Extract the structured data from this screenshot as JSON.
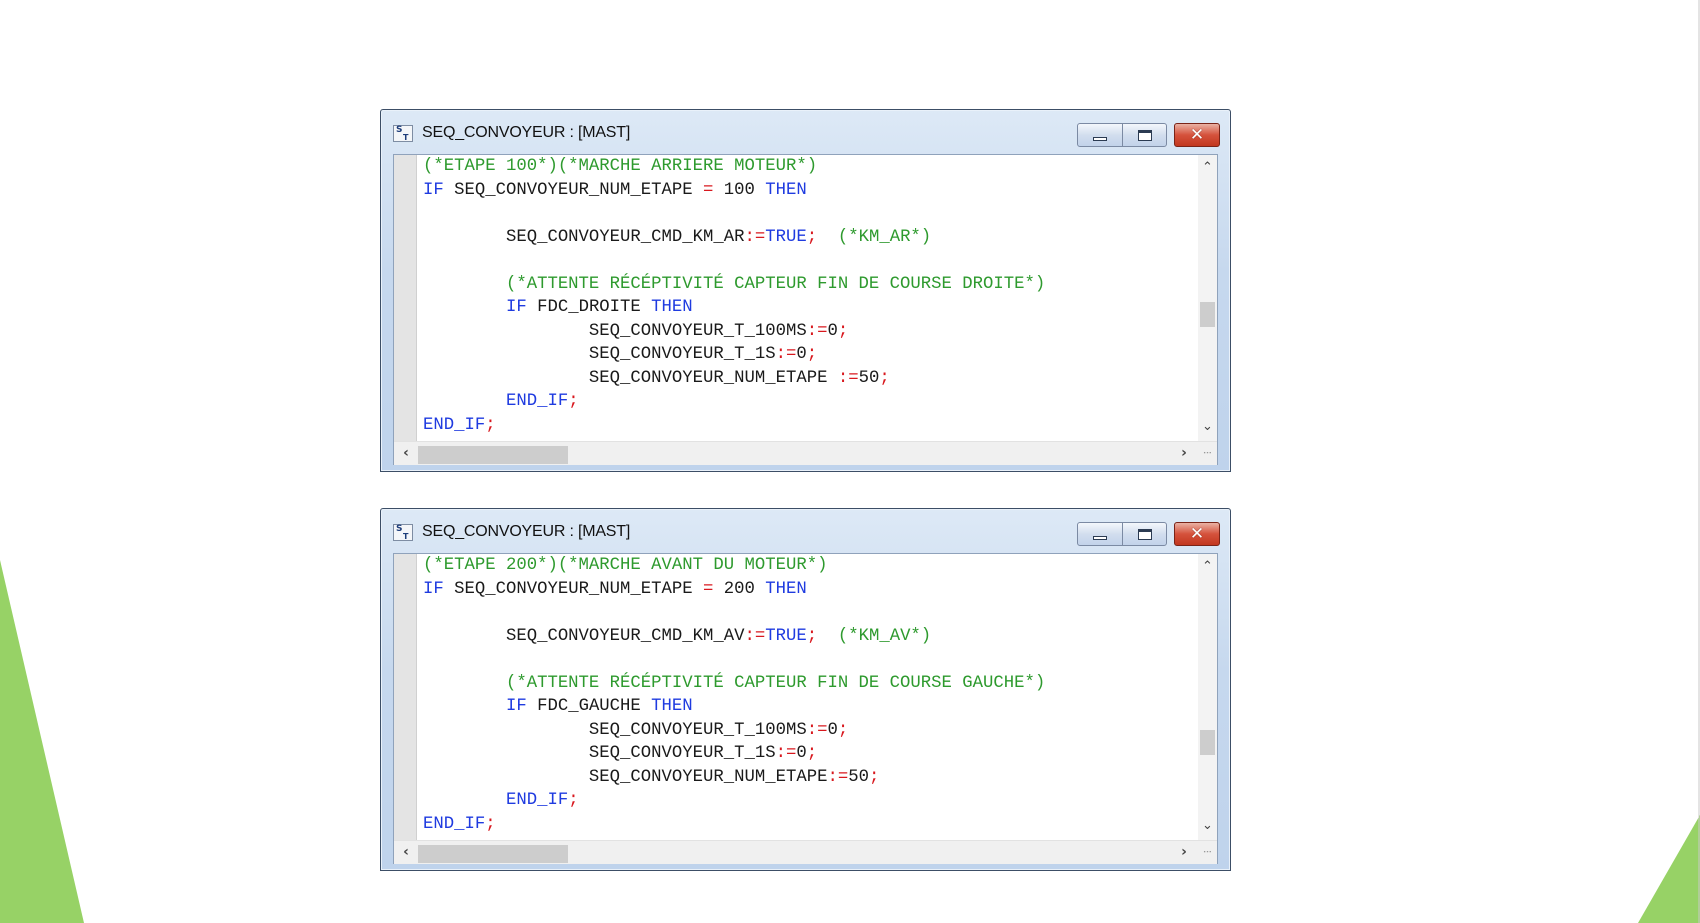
{
  "colors": {
    "comment": "#2e9a2e",
    "keyword": "#1f3be0",
    "identifier": "#1a1a1a",
    "operator": "#d8181e",
    "slide_accent": "#97d266"
  },
  "windows": [
    {
      "title": "SEQ_CONVOYEUR : [MAST]",
      "icon_text": "S",
      "icon_subtext": "T",
      "lines": [
        [
          {
            "t": "(*ETAPE 100*)(*MARCHE ARRIERE MOTEUR*)",
            "c": "cm"
          }
        ],
        [
          {
            "t": "IF",
            "c": "kw"
          },
          {
            "t": " SEQ_CONVOYEUR_NUM_ETAPE ",
            "c": "id"
          },
          {
            "t": "=",
            "c": "op"
          },
          {
            "t": " 100 ",
            "c": "id"
          },
          {
            "t": "THEN",
            "c": "kw"
          }
        ],
        [],
        [
          {
            "t": "        SEQ_CONVOYEUR_CMD_KM_AR",
            "c": "id"
          },
          {
            "t": ":=",
            "c": "op"
          },
          {
            "t": "TRUE",
            "c": "kw"
          },
          {
            "t": ";",
            "c": "op"
          },
          {
            "t": "  ",
            "c": "id"
          },
          {
            "t": "(*KM_AR*)",
            "c": "cm"
          }
        ],
        [],
        [
          {
            "t": "        (*ATTENTE RÉCÉPTIVITÉ CAPTEUR FIN DE COURSE DROITE*)",
            "c": "cm"
          }
        ],
        [
          {
            "t": "        IF",
            "c": "kw"
          },
          {
            "t": " FDC_DROITE ",
            "c": "id"
          },
          {
            "t": "THEN",
            "c": "kw"
          }
        ],
        [
          {
            "t": "                SEQ_CONVOYEUR_T_100MS",
            "c": "id"
          },
          {
            "t": ":=",
            "c": "op"
          },
          {
            "t": "0",
            "c": "id"
          },
          {
            "t": ";",
            "c": "op"
          }
        ],
        [
          {
            "t": "                SEQ_CONVOYEUR_T_1S",
            "c": "id"
          },
          {
            "t": ":=",
            "c": "op"
          },
          {
            "t": "0",
            "c": "id"
          },
          {
            "t": ";",
            "c": "op"
          }
        ],
        [
          {
            "t": "                SEQ_CONVOYEUR_NUM_ETAPE ",
            "c": "id"
          },
          {
            "t": ":=",
            "c": "op"
          },
          {
            "t": "50",
            "c": "id"
          },
          {
            "t": ";",
            "c": "op"
          }
        ],
        [
          {
            "t": "        END_IF",
            "c": "kw"
          },
          {
            "t": ";",
            "c": "op"
          }
        ],
        [
          {
            "t": "END_IF",
            "c": "kw"
          },
          {
            "t": ";",
            "c": "op"
          }
        ]
      ],
      "v_scroll_position": 0.58
    },
    {
      "title": "SEQ_CONVOYEUR : [MAST]",
      "icon_text": "S",
      "icon_subtext": "T",
      "lines": [
        [
          {
            "t": "(*ETAPE 200*)(*MARCHE AVANT DU MOTEUR*)",
            "c": "cm"
          }
        ],
        [
          {
            "t": "IF",
            "c": "kw"
          },
          {
            "t": " SEQ_CONVOYEUR_NUM_ETAPE ",
            "c": "id"
          },
          {
            "t": "=",
            "c": "op"
          },
          {
            "t": " 200 ",
            "c": "id"
          },
          {
            "t": "THEN",
            "c": "kw"
          }
        ],
        [],
        [
          {
            "t": "        SEQ_CONVOYEUR_CMD_KM_AV",
            "c": "id"
          },
          {
            "t": ":=",
            "c": "op"
          },
          {
            "t": "TRUE",
            "c": "kw"
          },
          {
            "t": ";",
            "c": "op"
          },
          {
            "t": "  ",
            "c": "id"
          },
          {
            "t": "(*KM_AV*)",
            "c": "cm"
          }
        ],
        [],
        [
          {
            "t": "        (*ATTENTE RÉCÉPTIVITÉ CAPTEUR FIN DE COURSE GAUCHE*)",
            "c": "cm"
          }
        ],
        [
          {
            "t": "        IF",
            "c": "kw"
          },
          {
            "t": " FDC_GAUCHE ",
            "c": "id"
          },
          {
            "t": "THEN",
            "c": "kw"
          }
        ],
        [
          {
            "t": "                SEQ_CONVOYEUR_T_100MS",
            "c": "id"
          },
          {
            "t": ":=",
            "c": "op"
          },
          {
            "t": "0",
            "c": "id"
          },
          {
            "t": ";",
            "c": "op"
          }
        ],
        [
          {
            "t": "                SEQ_CONVOYEUR_T_1S",
            "c": "id"
          },
          {
            "t": ":=",
            "c": "op"
          },
          {
            "t": "0",
            "c": "id"
          },
          {
            "t": ";",
            "c": "op"
          }
        ],
        [
          {
            "t": "                SEQ_CONVOYEUR_NUM_ETAPE",
            "c": "id"
          },
          {
            "t": ":=",
            "c": "op"
          },
          {
            "t": "50",
            "c": "id"
          },
          {
            "t": ";",
            "c": "op"
          }
        ],
        [
          {
            "t": "        END_IF",
            "c": "kw"
          },
          {
            "t": ";",
            "c": "op"
          }
        ],
        [
          {
            "t": "END_IF",
            "c": "kw"
          },
          {
            "t": ";",
            "c": "op"
          }
        ]
      ],
      "v_scroll_position": 0.72
    }
  ]
}
